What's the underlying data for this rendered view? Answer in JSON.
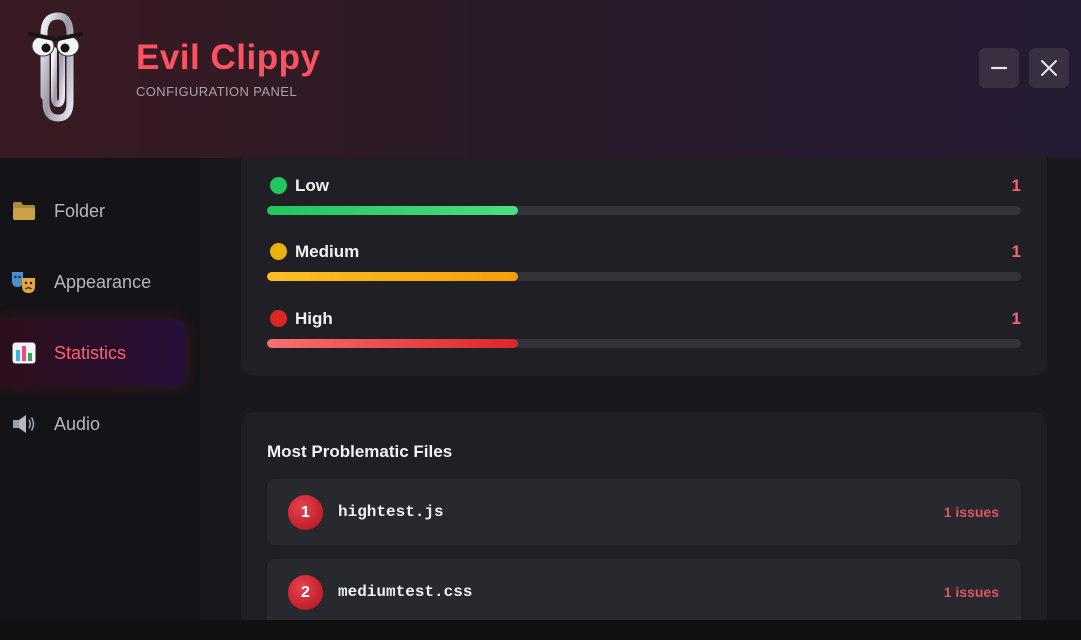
{
  "app": {
    "title": "Evil Clippy",
    "subtitle": "CONFIGURATION PANEL",
    "accent_color": "#ff5260"
  },
  "window_controls": {
    "minimize_icon": "minus-icon",
    "close_icon": "close-icon"
  },
  "sidebar": {
    "items": [
      {
        "label": "Folder",
        "icon": "folder-icon",
        "active": false
      },
      {
        "label": "Appearance",
        "icon": "theater-masks-icon",
        "active": false
      },
      {
        "label": "Statistics",
        "icon": "bar-chart-icon",
        "active": true
      },
      {
        "label": "Audio",
        "icon": "speaker-icon",
        "active": false
      }
    ]
  },
  "severity": {
    "items": [
      {
        "label": "Low",
        "count": "1",
        "fill_fraction": 0.333,
        "dot_color": "#22c55e",
        "bar_color_start": "#22c55e",
        "bar_color_end": "#4ade80"
      },
      {
        "label": "Medium",
        "count": "1",
        "fill_fraction": 0.333,
        "dot_color": "#eab308",
        "bar_color_start": "#fbbf24",
        "bar_color_end": "#f59e0b"
      },
      {
        "label": "High",
        "count": "1",
        "fill_fraction": 0.333,
        "dot_color": "#dc2626",
        "bar_color_start": "#f87171",
        "bar_color_end": "#dc2626"
      }
    ]
  },
  "files": {
    "title": "Most Problematic Files",
    "items": [
      {
        "rank": "1",
        "name": "hightest.js",
        "issues": "1 issues"
      },
      {
        "rank": "2",
        "name": "mediumtest.css",
        "issues": "1 issues"
      }
    ]
  }
}
